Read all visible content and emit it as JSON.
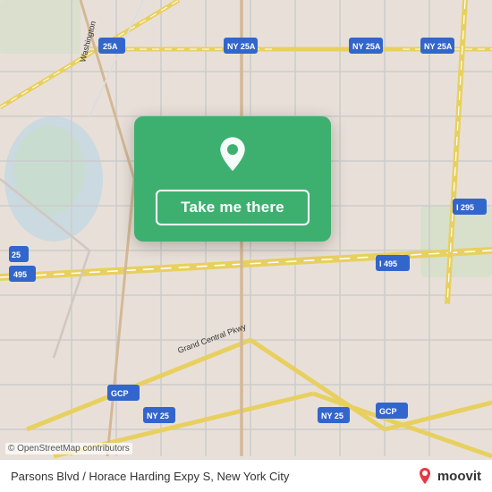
{
  "map": {
    "attribution": "© OpenStreetMap contributors",
    "background_color": "#e8e0d8"
  },
  "card": {
    "button_label": "Take me there",
    "pin_color": "white",
    "background_color": "#3db070"
  },
  "bottom_bar": {
    "address": "Parsons Blvd / Horace Harding Expy S, New York City",
    "logo_letter": "m",
    "logo_word": "moovit"
  },
  "copyright": "© OpenStreetMap contributors"
}
